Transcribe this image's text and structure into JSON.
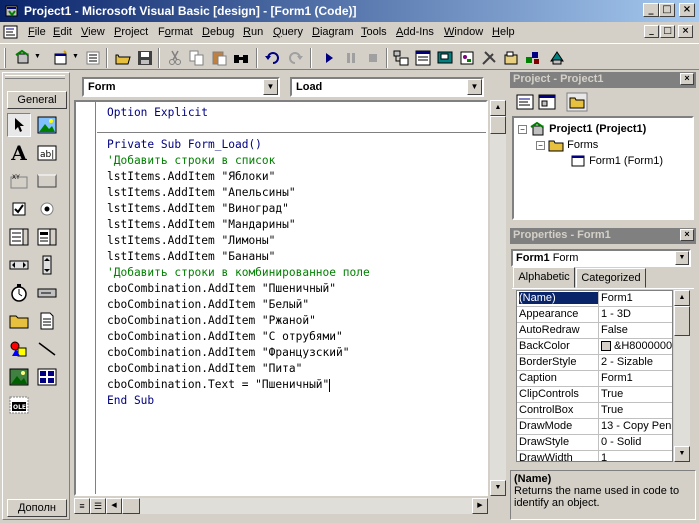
{
  "window": {
    "title": "Project1 - Microsoft Visual Basic [design] - [Form1 (Code)]",
    "minimize": "_",
    "maximize": "□",
    "close": "×",
    "mdi_minimize": "_",
    "mdi_restore": "□",
    "mdi_close": "×"
  },
  "menu": {
    "items": [
      {
        "label": "File",
        "key": "F"
      },
      {
        "label": "Edit",
        "key": "E"
      },
      {
        "label": "View",
        "key": "V"
      },
      {
        "label": "Project",
        "key": "P"
      },
      {
        "label": "Format",
        "key": "o"
      },
      {
        "label": "Debug",
        "key": "D"
      },
      {
        "label": "Run",
        "key": "R"
      },
      {
        "label": "Query",
        "key": "Q"
      },
      {
        "label": "Diagram",
        "key": "D"
      },
      {
        "label": "Tools",
        "key": "T"
      },
      {
        "label": "Add-Ins",
        "key": "A"
      },
      {
        "label": "Window",
        "key": "W"
      },
      {
        "label": "Help",
        "key": "H"
      }
    ]
  },
  "toolbox": {
    "tab_general": "General",
    "tab_extra": "Дополн"
  },
  "code": {
    "object_combo": "Form",
    "procedure_combo": "Load",
    "lines": [
      {
        "text": "Option Explicit",
        "kind": "kw"
      },
      {
        "text": "",
        "kind": "sep"
      },
      {
        "text": "Private Sub Form_Load()",
        "kind": "kw"
      },
      {
        "text": "'Добавить строки в список",
        "kind": "cm"
      },
      {
        "text": "lstItems.AddItem \"Яблоки\"",
        "kind": "code"
      },
      {
        "text": "lstItems.AddItem \"Апельсины\"",
        "kind": "code"
      },
      {
        "text": "lstItems.AddItem \"Виноград\"",
        "kind": "code"
      },
      {
        "text": "lstItems.AddItem \"Мандарины\"",
        "kind": "code"
      },
      {
        "text": "lstItems.AddItem \"Лимоны\"",
        "kind": "code"
      },
      {
        "text": "lstItems.AddItem \"Бананы\"",
        "kind": "code"
      },
      {
        "text": "",
        "kind": "code"
      },
      {
        "text": "'Добавить строки в комбинированное поле",
        "kind": "cm"
      },
      {
        "text": "cboCombination.AddItem \"Пшеничный\"",
        "kind": "code"
      },
      {
        "text": "cboCombination.AddItem \"Белый\"",
        "kind": "code"
      },
      {
        "text": "cboCombination.AddItem \"Ржаной\"",
        "kind": "code"
      },
      {
        "text": "cboCombination.AddItem \"С отрубями\"",
        "kind": "code"
      },
      {
        "text": "cboCombination.AddItem \"Французский\"",
        "kind": "code"
      },
      {
        "text": "cboCombination.AddItem \"Пита\"",
        "kind": "code"
      },
      {
        "text": "cboCombination.Text = \"Пшеничный\"",
        "kind": "code"
      },
      {
        "text": "",
        "kind": "code"
      },
      {
        "text": "End Sub",
        "kind": "kw"
      }
    ]
  },
  "project": {
    "header": "Project - Project1",
    "root": "Project1 (Project1)",
    "folder": "Forms",
    "form": "Form1 (Form1)"
  },
  "properties": {
    "header": "Properties - Form1",
    "object_name": "Form1",
    "object_type": "Form",
    "tab_alphabetic": "Alphabetic",
    "tab_categorized": "Categorized",
    "rows": [
      {
        "name": "(Name)",
        "value": "Form1"
      },
      {
        "name": "Appearance",
        "value": "1 - 3D"
      },
      {
        "name": "AutoRedraw",
        "value": "False"
      },
      {
        "name": "BackColor",
        "value": "&H8000000"
      },
      {
        "name": "BorderStyle",
        "value": "2 - Sizable"
      },
      {
        "name": "Caption",
        "value": "Form1"
      },
      {
        "name": "ClipControls",
        "value": "True"
      },
      {
        "name": "ControlBox",
        "value": "True"
      },
      {
        "name": "DrawMode",
        "value": "13 - Copy Pen"
      },
      {
        "name": "DrawStyle",
        "value": "0 - Solid"
      },
      {
        "name": "DrawWidth",
        "value": "1"
      }
    ],
    "desc_title": "(Name)",
    "desc_text": "Returns the name used in code to identify an object."
  }
}
